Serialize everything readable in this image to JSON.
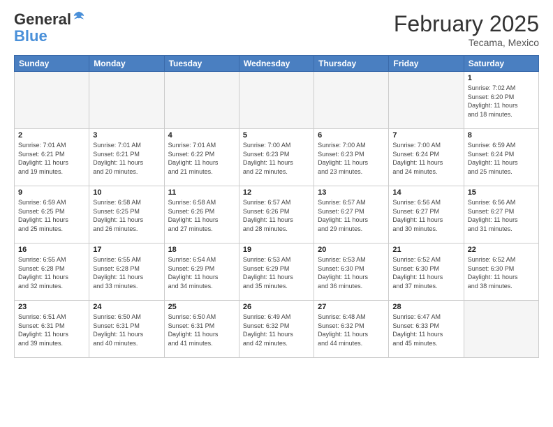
{
  "header": {
    "logo_general": "General",
    "logo_blue": "Blue",
    "month_title": "February 2025",
    "location": "Tecama, Mexico"
  },
  "days_of_week": [
    "Sunday",
    "Monday",
    "Tuesday",
    "Wednesday",
    "Thursday",
    "Friday",
    "Saturday"
  ],
  "weeks": [
    [
      {
        "day": "",
        "info": ""
      },
      {
        "day": "",
        "info": ""
      },
      {
        "day": "",
        "info": ""
      },
      {
        "day": "",
        "info": ""
      },
      {
        "day": "",
        "info": ""
      },
      {
        "day": "",
        "info": ""
      },
      {
        "day": "1",
        "info": "Sunrise: 7:02 AM\nSunset: 6:20 PM\nDaylight: 11 hours\nand 18 minutes."
      }
    ],
    [
      {
        "day": "2",
        "info": "Sunrise: 7:01 AM\nSunset: 6:21 PM\nDaylight: 11 hours\nand 19 minutes."
      },
      {
        "day": "3",
        "info": "Sunrise: 7:01 AM\nSunset: 6:21 PM\nDaylight: 11 hours\nand 20 minutes."
      },
      {
        "day": "4",
        "info": "Sunrise: 7:01 AM\nSunset: 6:22 PM\nDaylight: 11 hours\nand 21 minutes."
      },
      {
        "day": "5",
        "info": "Sunrise: 7:00 AM\nSunset: 6:23 PM\nDaylight: 11 hours\nand 22 minutes."
      },
      {
        "day": "6",
        "info": "Sunrise: 7:00 AM\nSunset: 6:23 PM\nDaylight: 11 hours\nand 23 minutes."
      },
      {
        "day": "7",
        "info": "Sunrise: 7:00 AM\nSunset: 6:24 PM\nDaylight: 11 hours\nand 24 minutes."
      },
      {
        "day": "8",
        "info": "Sunrise: 6:59 AM\nSunset: 6:24 PM\nDaylight: 11 hours\nand 25 minutes."
      }
    ],
    [
      {
        "day": "9",
        "info": "Sunrise: 6:59 AM\nSunset: 6:25 PM\nDaylight: 11 hours\nand 25 minutes."
      },
      {
        "day": "10",
        "info": "Sunrise: 6:58 AM\nSunset: 6:25 PM\nDaylight: 11 hours\nand 26 minutes."
      },
      {
        "day": "11",
        "info": "Sunrise: 6:58 AM\nSunset: 6:26 PM\nDaylight: 11 hours\nand 27 minutes."
      },
      {
        "day": "12",
        "info": "Sunrise: 6:57 AM\nSunset: 6:26 PM\nDaylight: 11 hours\nand 28 minutes."
      },
      {
        "day": "13",
        "info": "Sunrise: 6:57 AM\nSunset: 6:27 PM\nDaylight: 11 hours\nand 29 minutes."
      },
      {
        "day": "14",
        "info": "Sunrise: 6:56 AM\nSunset: 6:27 PM\nDaylight: 11 hours\nand 30 minutes."
      },
      {
        "day": "15",
        "info": "Sunrise: 6:56 AM\nSunset: 6:27 PM\nDaylight: 11 hours\nand 31 minutes."
      }
    ],
    [
      {
        "day": "16",
        "info": "Sunrise: 6:55 AM\nSunset: 6:28 PM\nDaylight: 11 hours\nand 32 minutes."
      },
      {
        "day": "17",
        "info": "Sunrise: 6:55 AM\nSunset: 6:28 PM\nDaylight: 11 hours\nand 33 minutes."
      },
      {
        "day": "18",
        "info": "Sunrise: 6:54 AM\nSunset: 6:29 PM\nDaylight: 11 hours\nand 34 minutes."
      },
      {
        "day": "19",
        "info": "Sunrise: 6:53 AM\nSunset: 6:29 PM\nDaylight: 11 hours\nand 35 minutes."
      },
      {
        "day": "20",
        "info": "Sunrise: 6:53 AM\nSunset: 6:30 PM\nDaylight: 11 hours\nand 36 minutes."
      },
      {
        "day": "21",
        "info": "Sunrise: 6:52 AM\nSunset: 6:30 PM\nDaylight: 11 hours\nand 37 minutes."
      },
      {
        "day": "22",
        "info": "Sunrise: 6:52 AM\nSunset: 6:30 PM\nDaylight: 11 hours\nand 38 minutes."
      }
    ],
    [
      {
        "day": "23",
        "info": "Sunrise: 6:51 AM\nSunset: 6:31 PM\nDaylight: 11 hours\nand 39 minutes."
      },
      {
        "day": "24",
        "info": "Sunrise: 6:50 AM\nSunset: 6:31 PM\nDaylight: 11 hours\nand 40 minutes."
      },
      {
        "day": "25",
        "info": "Sunrise: 6:50 AM\nSunset: 6:31 PM\nDaylight: 11 hours\nand 41 minutes."
      },
      {
        "day": "26",
        "info": "Sunrise: 6:49 AM\nSunset: 6:32 PM\nDaylight: 11 hours\nand 42 minutes."
      },
      {
        "day": "27",
        "info": "Sunrise: 6:48 AM\nSunset: 6:32 PM\nDaylight: 11 hours\nand 44 minutes."
      },
      {
        "day": "28",
        "info": "Sunrise: 6:47 AM\nSunset: 6:33 PM\nDaylight: 11 hours\nand 45 minutes."
      },
      {
        "day": "",
        "info": ""
      }
    ]
  ]
}
